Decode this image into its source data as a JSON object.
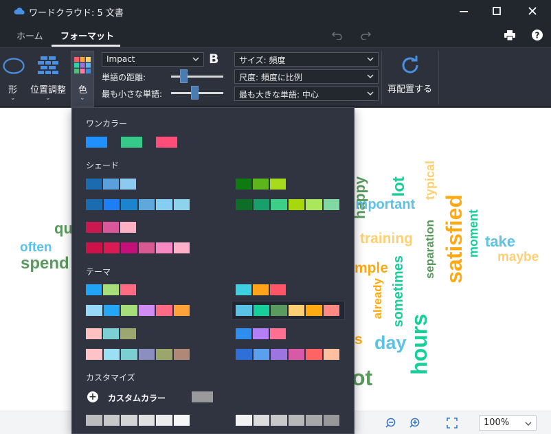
{
  "window": {
    "title": "ワードクラウド: 5 文書",
    "accent": "#4a90e2"
  },
  "tabs": [
    {
      "label": "ホーム"
    },
    {
      "label": "フォーマット"
    }
  ],
  "ribbon": {
    "shape_label": "形",
    "layout_label": "位置調整",
    "color_label": "色",
    "font_value": "Impact",
    "bold_label": "B",
    "spacing_label": "単語の距離:",
    "min_word_label": "最も小さな単語:",
    "size_select": "サイズ: 頻度",
    "scale_select": "尺度: 頻度に比例",
    "max_word_select": "最も大きな単語: 中心",
    "rearrange_label": "再配置する",
    "spacing_value": 0.24,
    "min_word_value": 0.45
  },
  "palette": {
    "single_title": "ワンカラー",
    "single": [
      "#1e90ff",
      "#35c98a",
      "#ff4d7a"
    ],
    "shade_title": "シェード",
    "shade_left": [
      [
        "#1a6bb0",
        "#5aa0da",
        "#8ccaf0"
      ],
      [
        "#1b6bb0",
        "#1e7ef5",
        "#1a84cf",
        "#5ea8dc",
        "#86cdf2",
        "#8dd3ec"
      ],
      [
        "#cc1850",
        "#d8589a",
        "#ffb0c4"
      ],
      [
        "#cc1248",
        "#da1a52",
        "#c4107a",
        "#d85a92",
        "#f58ac4",
        "#ffafc8"
      ]
    ],
    "shade_right": [
      [
        "#0d7b12",
        "#5db51c",
        "#a7db1e"
      ],
      [
        "#0e6e28",
        "#17a06a",
        "#3dcf86",
        "#a6d80c",
        "#a9e85a",
        "#7fd9a0"
      ]
    ],
    "theme_title": "テーマ",
    "theme_left": [
      [
        "#21a4f5",
        "#a6de7a",
        "#ff6b82"
      ],
      [
        "#98d8f8",
        "#24a8f5",
        "#a6de7a",
        "#d08cf5",
        "#ff6b82",
        "#ffa23a"
      ],
      [
        "#ffc0c0",
        "#7ccfd2",
        "#9ca66e"
      ],
      [
        "#ffc2c6",
        "#9adff2",
        "#7ccfd0",
        "#8b8fc0",
        "#9aa66c",
        "#b08878"
      ]
    ],
    "theme_right": [
      [
        "#3ecfe0",
        "#ffa31a",
        "#ff5566"
      ],
      [
        "#5bc2e8",
        "#17cf9a",
        "#5a9a5e",
        "#ffd073",
        "#ffaa12",
        "#ff8a84"
      ],
      [
        "#2e8ef0",
        "#b47ef5",
        "#ff7090"
      ],
      [
        "#2f6fd8",
        "#5aa0ec",
        "#9d75e0",
        "#d85aa6",
        "#ff6464",
        "#ffc0a0"
      ]
    ],
    "custom_title": "カスタマイズ",
    "custom_label": "カスタムカラー",
    "custom_left": [
      "#bcbcbc",
      "#c8c8c8",
      "#d4d4d4",
      "#e0e0e0",
      "#ececec",
      "#f6f6f6"
    ],
    "custom_right": [
      "#f2f2f2",
      "#dcdcdc",
      "#c8c8c8",
      "#b8b8b8",
      "#a8a8a8",
      "#989898"
    ]
  },
  "cloud_words": [
    {
      "text": "happy",
      "color": "#5a9a5e"
    },
    {
      "text": "typical",
      "color": "#ffd073"
    },
    {
      "text": "lot",
      "color": "#17cf9a"
    },
    {
      "text": "important",
      "color": "#5bc2e8"
    },
    {
      "text": "satisfied",
      "color": "#ffaa12"
    },
    {
      "text": "moment",
      "color": "#17cf9a"
    },
    {
      "text": "take",
      "color": "#5bc2e8"
    },
    {
      "text": "training",
      "color": "#ffd073"
    },
    {
      "text": "separation",
      "color": "#5a9a5e"
    },
    {
      "text": "maybe",
      "color": "#ffd073"
    },
    {
      "text": "sometimes",
      "color": "#17cf9a"
    },
    {
      "text": "mple",
      "color": "#ffaa12"
    },
    {
      "text": "already",
      "color": "#ffaa12"
    },
    {
      "text": "hours",
      "color": "#17cf9a"
    },
    {
      "text": "day",
      "color": "#5bc2e8"
    },
    {
      "text": "s",
      "color": "#ffaa12"
    },
    {
      "text": "ot",
      "color": "#5a9a5e"
    },
    {
      "text": "qu",
      "color": "#5a9a5e"
    },
    {
      "text": "often",
      "color": "#5bc2e8"
    },
    {
      "text": "spend",
      "color": "#5a9a5e"
    }
  ],
  "status": {
    "zoom": "100%"
  }
}
